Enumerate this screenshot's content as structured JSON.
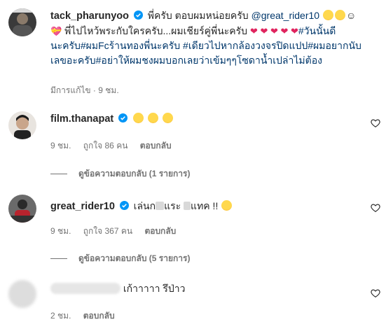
{
  "comments": [
    {
      "username": "tack_pharunyoo",
      "verified": true,
      "text_part1": "พี่ครับ ตอบผมหน่อยครับ",
      "mention": "@great_rider10",
      "text_part2": "พี่ไปไหว้พระกับใครครับ...ผมเชียร์คู่พี่นะครับ",
      "hashtags": "#วันนั้นดี",
      "line3": "นะครับ#ผมFcร้านทองพี่นะครับ #เดียวไปหากล้องวงจรปิดแปป#ผมอยากนับ",
      "line4": "เลขอะครับ#อย่าให้ผมชงผมบอกเลยว่าเข้มๆๆโซดาน้ำเปล่าไม่ต้อง",
      "meta": "มีการแก้ไข · 9 ชม."
    },
    {
      "username": "film.thanapat",
      "verified": true,
      "time": "9 ชม.",
      "likes": "ถูกใจ 86 คน",
      "reply": "ตอบกลับ",
      "view_replies": "ดูข้อความตอบกลับ (1 รายการ)"
    },
    {
      "username": "great_rider10",
      "verified": true,
      "text_a": "เล่นก",
      "text_b": "แระ",
      "text_c": "แทค !!",
      "time": "9 ชม.",
      "likes": "ถูกใจ 367 คน",
      "reply": "ตอบกลับ",
      "view_replies": "ดูข้อความตอบกลับ (5 รายการ)"
    },
    {
      "text": "เก้าาาาา รึป่าว",
      "time": "2 ชม.",
      "reply": "ตอบกลับ"
    }
  ],
  "icons": {
    "verified": "verified-badge-icon",
    "like": "heart-outline-icon",
    "laugh": "laughing-emoji-icon"
  },
  "colors": {
    "verified": "#0095f6",
    "link": "#00376b",
    "meta": "#737373",
    "red_heart": "#e0245e"
  }
}
